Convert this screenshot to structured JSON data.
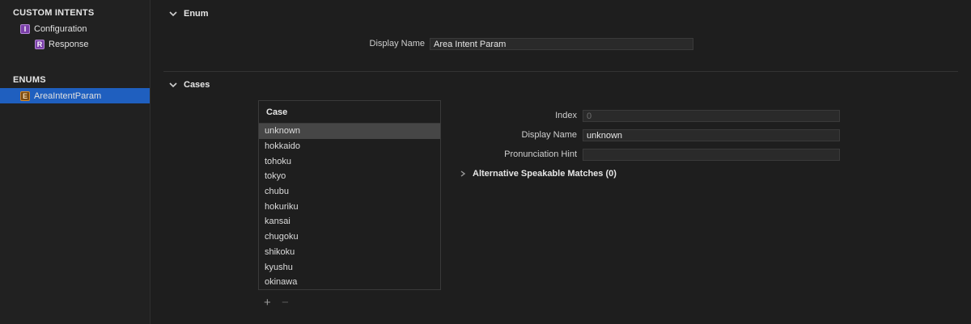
{
  "sidebar": {
    "custom_intents_header": "CUSTOM INTENTS",
    "configuration": {
      "badge": "I",
      "label": "Configuration"
    },
    "response": {
      "badge": "R",
      "label": "Response"
    },
    "enums_header": "ENUMS",
    "enum_item": {
      "badge": "E",
      "label": "AreaIntentParam"
    }
  },
  "enum_section": {
    "title": "Enum",
    "display_name_label": "Display Name",
    "display_name_value": "Area Intent Param"
  },
  "cases_section": {
    "title": "Cases",
    "table_header": "Case",
    "cases": [
      "unknown",
      "hokkaido",
      "tohoku",
      "tokyo",
      "chubu",
      "hokuriku",
      "kansai",
      "chugoku",
      "shikoku",
      "kyushu",
      "okinawa"
    ],
    "selected_case": "unknown",
    "add_label": "+",
    "remove_label": "−"
  },
  "case_detail": {
    "index_label": "Index",
    "index_value": "0",
    "display_name_label": "Display Name",
    "display_name_value": "unknown",
    "pronunciation_label": "Pronunciation Hint",
    "pronunciation_value": "",
    "alt_matches_label": "Alternative Speakable Matches (0)"
  },
  "colors": {
    "selection": "#1f5fbf",
    "background": "#1e1e1e"
  }
}
